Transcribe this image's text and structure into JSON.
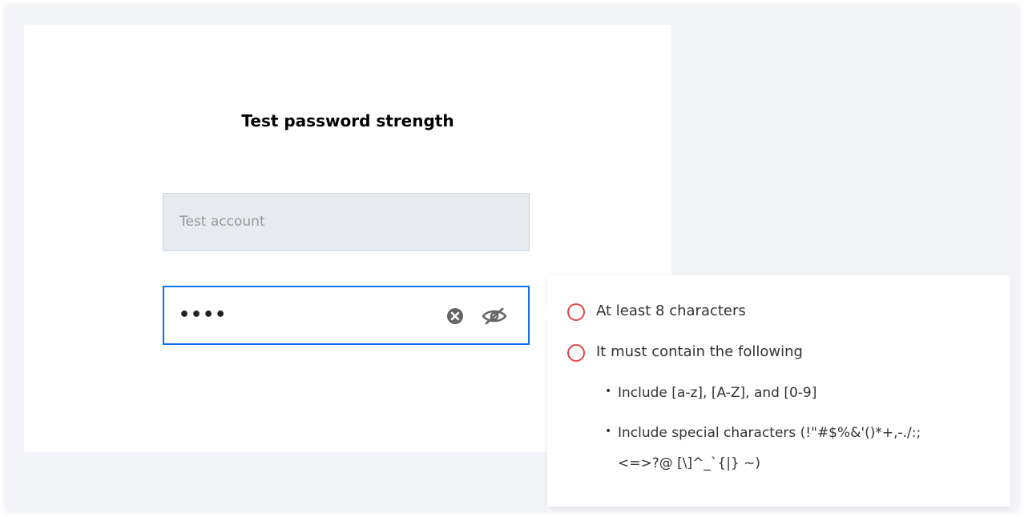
{
  "page": {
    "title": "Test password strength"
  },
  "form": {
    "account": {
      "placeholder": "Test account",
      "value": ""
    },
    "password": {
      "masked_value": "••••",
      "clear_icon": "clear-icon",
      "visibility_icon": "eye-off-icon"
    }
  },
  "requirements": {
    "status_color": "#e54545",
    "items": [
      {
        "label": "At least 8 characters",
        "met": false
      },
      {
        "label": "It must contain the following",
        "met": false
      }
    ],
    "sub_items": [
      {
        "label": "Include [a-z], [A-Z], and [0-9]"
      },
      {
        "label_line1": "Include special characters (!\"#$%&'()*+,-./:;",
        "label_line2": "<=>?@ [\\]^_`{|} ~)"
      }
    ]
  },
  "colors": {
    "accent_border": "#0c6ef2",
    "backdrop": "#f3f4f7",
    "account_fill": "#e7eaef"
  }
}
